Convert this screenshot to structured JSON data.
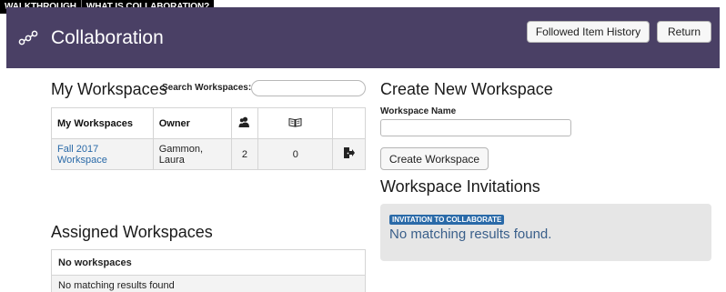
{
  "topbar": {
    "tabs": [
      "WALKTHROUGH",
      "WHAT IS COLLABORATION?"
    ]
  },
  "header": {
    "title": "Collaboration",
    "logo_icon": "collaboration-nodes-icon",
    "buttons": {
      "history": "Followed Item History",
      "return": "Return"
    }
  },
  "my_workspaces": {
    "title": "My Workspaces",
    "search_label": "Search Workspaces:",
    "search_value": "",
    "columns": {
      "name": "My Workspaces",
      "owner": "Owner",
      "members_icon": "members-icon",
      "items_icon": "book-icon"
    },
    "rows": [
      {
        "name": "Fall 2017 Workspace",
        "owner": "Gammon, Laura",
        "members": "2",
        "items": "0",
        "action_icon": "leave-workspace-icon"
      }
    ]
  },
  "assigned_workspaces": {
    "title": "Assigned Workspaces",
    "header": "No workspaces",
    "message": "No matching results found"
  },
  "create_workspace": {
    "title": "Create New Workspace",
    "name_label": "Workspace Name",
    "name_value": "",
    "button": "Create Workspace"
  },
  "invitations": {
    "title": "Workspace Invitations",
    "badge": "INVITATION TO COLLABORATE",
    "message": "No matching results found."
  },
  "colors": {
    "header_bg": "#4a4065",
    "link": "#2a6aa8",
    "badge_bg": "#2a6aa8",
    "panel_bg": "#e6e6e6"
  }
}
